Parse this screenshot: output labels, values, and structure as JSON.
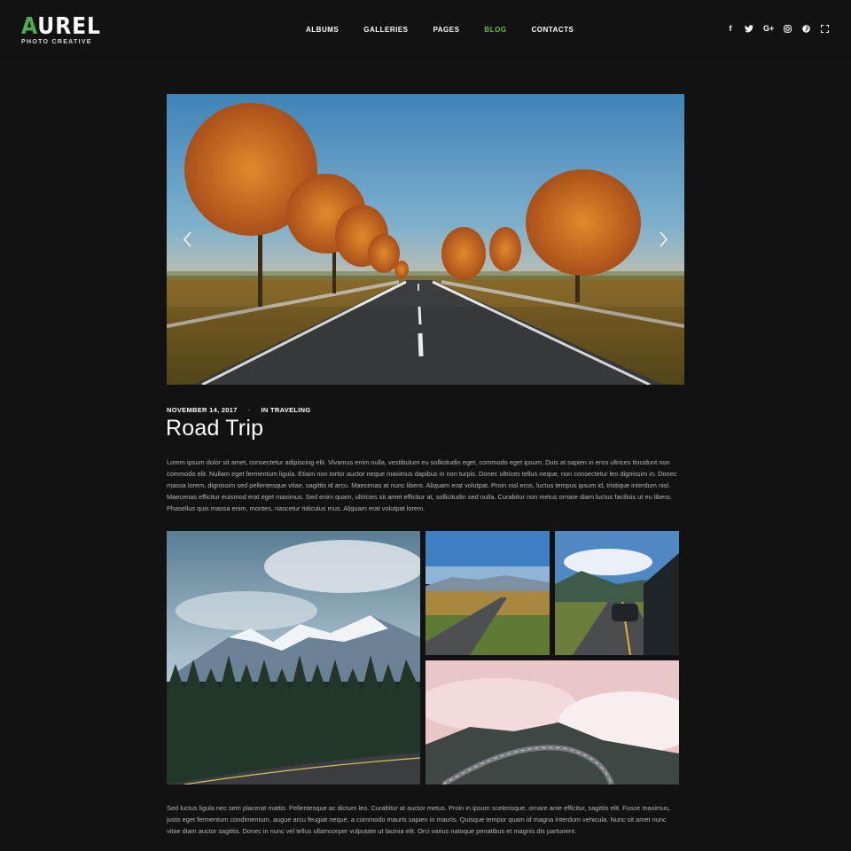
{
  "logo": {
    "first_letter": "A",
    "rest": "UREL",
    "tagline": "PHOTO CREATIVE"
  },
  "nav": {
    "items": [
      {
        "label": "ALBUMS"
      },
      {
        "label": "GALLERIES"
      },
      {
        "label": "PAGES"
      },
      {
        "label": "BLOG",
        "active": true
      },
      {
        "label": "CONTACTS"
      }
    ]
  },
  "social": {
    "icons": [
      "facebook-icon",
      "twitter-icon",
      "google-plus-icon",
      "instagram-icon",
      "pinterest-icon",
      "fullscreen-icon"
    ],
    "facebook": "f",
    "googleplus": "G+"
  },
  "post": {
    "date": "NOVEMBER 14, 2017",
    "separator": "·",
    "category": "IN TRAVELING",
    "title": "Road Trip",
    "paragraph1": "Lorem ipsum dolor sit amet, consectetur adipiscing elit. Vivamus enim nulla, vestibulum eu sollicitudin eget, commodo eget ipsum. Duis at sapien in eros ultrices tincidunt non commodo elit. Nullam eget fermentum ligula. Etiam non tortor auctor neque maximus dapibus in non turpis. Donec ultrices tellus neque, non consectetur leo dignissim in. Donec massa lorem, dignissim sed pellentesque vitae, sagittis id arcu. Maecenas at nunc libero. Aliquam erat volutpat. Proin nisl eros, luctus tempus ipsum id, tristique interdum nisl. Maecenas efficitur euismod erat eget maximus. Sed enim quam, ultricies sit amet efficitur at, sollicitudin sed nulla. Curabitur non metus ornare diam luctus facilisis ut eu libero. Phasellus quis massa enim, montes, nascetur ridiculus mus. Aliquam erat volutpat lorem.",
    "paragraph2": "Sed luctus ligula nec sem placerat mattis. Pellentesque ac dictum leo. Curabitur at auctor metus. Proin in ipsum scelerisque, ornare ante efficitur, sagittis elit. Fusce maximus, justo eget fermentum condimentum, augue arcu feugiat neque, a commodo mauris sapien in mauris. Quisque tempor quam id magna interdum vehicula. Nunc sit amet nunc vitae diam auctor sagittis. Donec in nunc vel tellus ullamcorper vulputate ut lacinia elit. Orci varius natoque penatibus et magnis dis parturient."
  },
  "colors": {
    "background": "#121212",
    "accent": "#6cbf45",
    "text": "#ffffff",
    "body_text": "#b5b5b5"
  }
}
